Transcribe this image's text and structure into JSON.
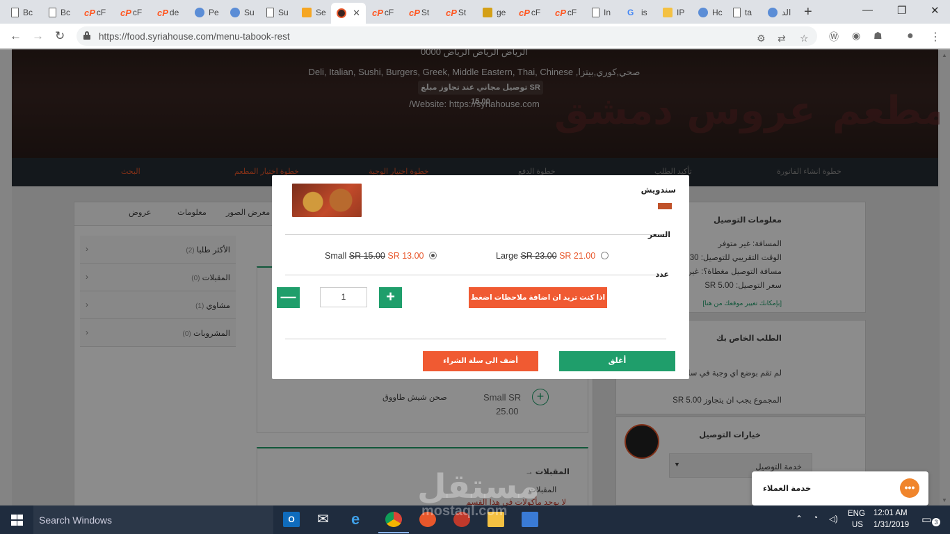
{
  "browser": {
    "tabs": [
      {
        "label": "Bc",
        "icon": "doc-icon"
      },
      {
        "label": "Bc",
        "icon": "doc-icon"
      },
      {
        "label": "cF",
        "icon": "cp-icon"
      },
      {
        "label": "cF",
        "icon": "cp-icon"
      },
      {
        "label": "de",
        "icon": "cp-icon"
      },
      {
        "label": "Pe",
        "icon": "pe-icon"
      },
      {
        "label": "Su",
        "icon": "su-icon"
      },
      {
        "label": "Su",
        "icon": "doc-icon"
      },
      {
        "label": "Se",
        "icon": "se-icon"
      },
      {
        "label": "",
        "icon": "active-site-icon",
        "active": true,
        "close": "✕"
      },
      {
        "label": "cF",
        "icon": "cp-icon"
      },
      {
        "label": "St",
        "icon": "cp-icon"
      },
      {
        "label": "St",
        "icon": "cp-icon"
      },
      {
        "label": "ge",
        "icon": "ge-icon"
      },
      {
        "label": "cF",
        "icon": "cp-icon"
      },
      {
        "label": "cF",
        "icon": "cp-icon"
      },
      {
        "label": "In",
        "icon": "doc-icon"
      },
      {
        "label": "is",
        "icon": "google-icon"
      },
      {
        "label": "IP",
        "icon": "ip-icon"
      },
      {
        "label": "Hc",
        "icon": "hc-icon"
      },
      {
        "label": "ta",
        "icon": "doc-icon"
      },
      {
        "label": "الد",
        "icon": "ar-icon"
      }
    ],
    "new_tab": "+",
    "window_controls": [
      "—",
      "❐",
      "✕"
    ],
    "url": "https://food.syriahouse.com/menu-tabook-rest"
  },
  "hero": {
    "address": "الرياض الرياض الرياض 0000",
    "cuisines": "Deli, Italian, Sushi, Burgers, Greek, Middle Eastern, Thai, Chinese ,صحي,كوري,بيتزا",
    "free_delivery": "توصيل مجاني عند تجاوز مبلغ SR 15.00",
    "website": "/Website: https://syriahouse.com"
  },
  "steps": [
    {
      "label": "خطوة انشاء الفاتورة",
      "orange": false
    },
    {
      "label": "تأكيد الطلب",
      "orange": false
    },
    {
      "label": "خطوة الدفع",
      "orange": false
    },
    {
      "label": "خطوة اختيار الوجبة",
      "orange": true
    },
    {
      "label": "خطوة اختيار المطعم",
      "orange": true
    },
    {
      "label": "البحث",
      "orange": true
    }
  ],
  "menu_tabs": [
    "عروض",
    "معلومات",
    "معرض الصور"
  ],
  "categories": [
    {
      "label": "الأكثر طلبا",
      "count": "(2)"
    },
    {
      "label": "المقبلات",
      "count": "(0)"
    },
    {
      "label": "مشاوي",
      "count": "(1)"
    },
    {
      "label": "المشروبات",
      "count": "(0)"
    }
  ],
  "menu_item": {
    "name": "صحن شيش طاووق",
    "price_line1": "Small SR",
    "price_line2": "25.00",
    "section": "→ المقبلات",
    "section_sub": "المقبلات",
    "section_note": "لا يوجد مأكولات في هذا القسم"
  },
  "delivery_info": {
    "title": "معلومات التوصيل",
    "distance": "المسافة: غير متوفر",
    "est_time": "الوقت التقريبي للتوصيل: 30 Min",
    "covered": "مسافة التوصيل مغطاة؟: غير متوفر",
    "price": "سعر التوصيل: SR 5.00",
    "change_location": "[بإمكانك تغيير موقعك من هنا]"
  },
  "order_panel": {
    "title": "الطلب الخاص بك",
    "empty": "لم تقم بوضع اي وجبة في سلة المشتريات",
    "min_total": "المجموع يجب ان يتجاوز SR 5.00"
  },
  "delivery_options": {
    "title": "خيارات التوصيل",
    "selected": "خدمة التوصيل",
    "arrow": "▼"
  },
  "modal": {
    "title": "سندويش",
    "price_label": "السعر",
    "qty_label": "عدد",
    "options": [
      {
        "size": "Small",
        "old": "SR 15.00",
        "new": "SR 13.00",
        "selected": true
      },
      {
        "size": "Large",
        "old": "SR 23.00",
        "new": "SR 21.00",
        "selected": false
      }
    ],
    "quantity": "1",
    "minus": "—",
    "plus": "+",
    "notes_button": "اذا كنت تريد ان اضافة ملاحظات اضغط هنا",
    "add_to_cart": "أضف الى سلة الشراء",
    "close": "أغلق"
  },
  "chat": {
    "label": "خدمة العملاء",
    "icon_glyph": "•••"
  },
  "watermark": {
    "arabic": "مستقل",
    "latin": "mostaql.com"
  },
  "taskbar": {
    "search": "Search Windows",
    "lang1": "ENG",
    "lang2": "US",
    "time": "12:01 AM",
    "date": "1/31/2019",
    "notifications": "3"
  },
  "colors": {
    "accent_orange": "#f05a32",
    "accent_green": "#1f9e6b",
    "steps_bg": "#262d33",
    "taskbar_bg": "#1f2c3e"
  }
}
